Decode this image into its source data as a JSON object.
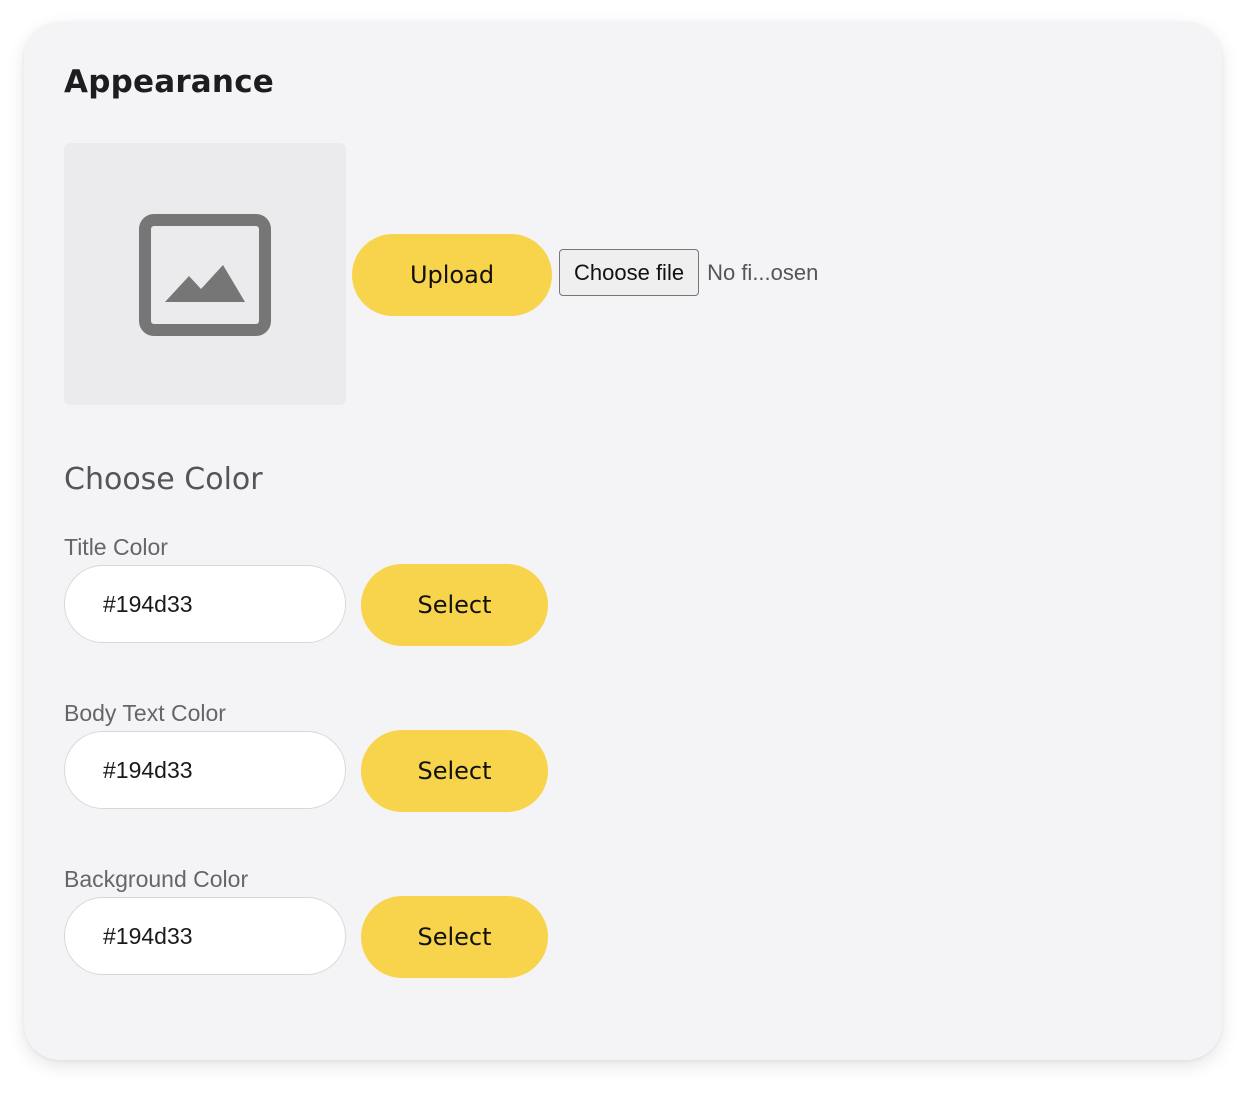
{
  "appearance": {
    "title": "Appearance",
    "upload_label": "Upload",
    "choose_file_label": "Choose file",
    "file_status": "No fi...osen",
    "image_icon": "image-icon"
  },
  "choose_color": {
    "heading": "Choose Color",
    "fields": [
      {
        "label": "Title Color",
        "value": "#194d33",
        "button": "Select"
      },
      {
        "label": "Body Text Color",
        "value": "#194d33",
        "button": "Select"
      },
      {
        "label": "Background Color",
        "value": "#194d33",
        "button": "Select"
      }
    ]
  },
  "colors": {
    "accent": "#f7d44c",
    "card_background": "#f4f4f6",
    "placeholder_background": "#ebebed",
    "icon": "#767676"
  }
}
